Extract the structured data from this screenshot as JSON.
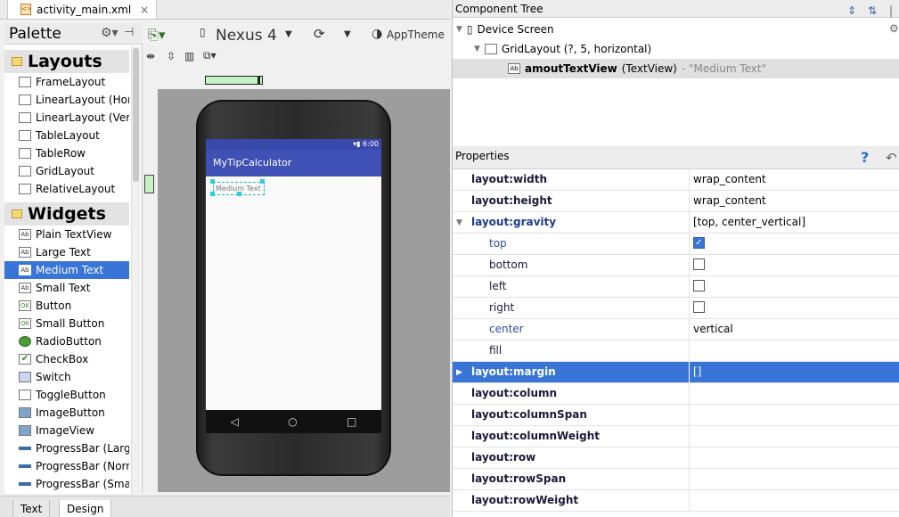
{
  "editor_tab": {
    "label": "activity_main.xml",
    "close": "×"
  },
  "palette": {
    "title": "Palette",
    "layouts_header": "Layouts",
    "layouts": [
      "FrameLayout",
      "LinearLayout (Horizontal)",
      "LinearLayout (Vertical)",
      "TableLayout",
      "TableRow",
      "GridLayout",
      "RelativeLayout"
    ],
    "widgets_header": "Widgets",
    "widgets": [
      {
        "label": "Plain TextView",
        "icon": "Ab"
      },
      {
        "label": "Large Text",
        "icon": "Ab"
      },
      {
        "label": "Medium Text",
        "icon": "Ab",
        "selected": true
      },
      {
        "label": "Small Text",
        "icon": "Ab"
      },
      {
        "label": "Button",
        "icon": "OK"
      },
      {
        "label": "Small Button",
        "icon": "OK"
      },
      {
        "label": "RadioButton",
        "icon": "radio-icon"
      },
      {
        "label": "CheckBox",
        "icon": "checkbox-icon"
      },
      {
        "label": "Switch",
        "icon": "switch-icon"
      },
      {
        "label": "ToggleButton",
        "icon": "toggle-icon"
      },
      {
        "label": "ImageButton",
        "icon": "image-icon"
      },
      {
        "label": "ImageView",
        "icon": "image-icon"
      },
      {
        "label": "ProgressBar (Large)",
        "icon": "progress-icon"
      },
      {
        "label": "ProgressBar (Normal)",
        "icon": "progress-icon"
      },
      {
        "label": "ProgressBar (Small)",
        "icon": "progress-icon"
      }
    ]
  },
  "toolbar": {
    "device": "Nexus 4",
    "theme": "AppTheme"
  },
  "preview": {
    "app_title": "MyTipCalculator",
    "status_time": "6:00",
    "medium_text": "Medium Text"
  },
  "bottom_tabs": {
    "text": "Text",
    "design": "Design"
  },
  "component_tree": {
    "title": "Component Tree",
    "device_screen": "Device Screen",
    "grid_layout": "GridLayout (?, 5, horizontal)",
    "text_view_id": "amoutTextView",
    "text_view_type": "(TextView)",
    "text_view_value": "- \"Medium Text\""
  },
  "properties": {
    "title": "Properties",
    "help": "?",
    "rows": [
      {
        "name": "layout:width",
        "value": "wrap_content"
      },
      {
        "name": "layout:height",
        "value": "wrap_content"
      },
      {
        "name": "layout:gravity",
        "value": "[top, center_vertical]"
      },
      {
        "name": "top",
        "value": ""
      },
      {
        "name": "bottom",
        "value": ""
      },
      {
        "name": "left",
        "value": ""
      },
      {
        "name": "right",
        "value": ""
      },
      {
        "name": "center",
        "value": "vertical"
      },
      {
        "name": "fill",
        "value": ""
      },
      {
        "name": "layout:margin",
        "value": "[]"
      },
      {
        "name": "layout:column",
        "value": ""
      },
      {
        "name": "layout:columnSpan",
        "value": ""
      },
      {
        "name": "layout:columnWeight",
        "value": ""
      },
      {
        "name": "layout:row",
        "value": ""
      },
      {
        "name": "layout:rowSpan",
        "value": ""
      },
      {
        "name": "layout:rowWeight",
        "value": ""
      }
    ],
    "gravity_checks": {
      "top": true,
      "bottom": false,
      "left": false,
      "right": false
    }
  },
  "colors": {
    "selection": "#3875d7",
    "app_bar": "#3f51b5",
    "status_bar": "#3949ab"
  }
}
